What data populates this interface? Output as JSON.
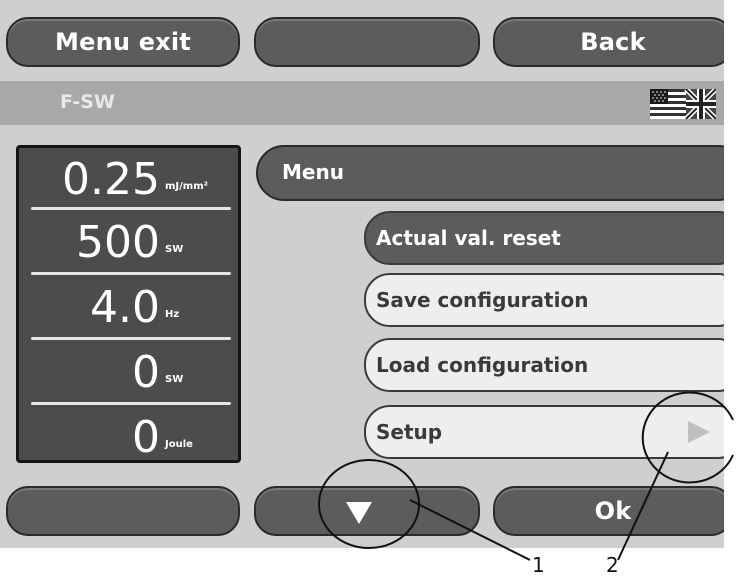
{
  "top_buttons": {
    "menu_exit": "Menu exit",
    "middle": "",
    "back": "Back"
  },
  "title_bar": {
    "title": "F-SW",
    "flag_icon": "us-uk-flag-icon"
  },
  "values": [
    {
      "value": "0.25",
      "unit": "mJ/mm²"
    },
    {
      "value": "500",
      "unit": "SW"
    },
    {
      "value": "4.0",
      "unit": "Hz"
    },
    {
      "value": "0",
      "unit": "SW"
    },
    {
      "value": "0",
      "unit": "Joule"
    }
  ],
  "menu": {
    "header": "Menu",
    "items": [
      {
        "label": "Actual val. reset",
        "state": "selected"
      },
      {
        "label": "Save configuration",
        "state": "normal"
      },
      {
        "label": "Load configuration",
        "state": "normal"
      },
      {
        "label": "Setup",
        "state": "normal",
        "has_arrow": true
      }
    ]
  },
  "bottom_buttons": {
    "left": "",
    "down_icon": "down-triangle-icon",
    "ok": "Ok"
  },
  "callouts": {
    "one": "1",
    "two": "2"
  }
}
